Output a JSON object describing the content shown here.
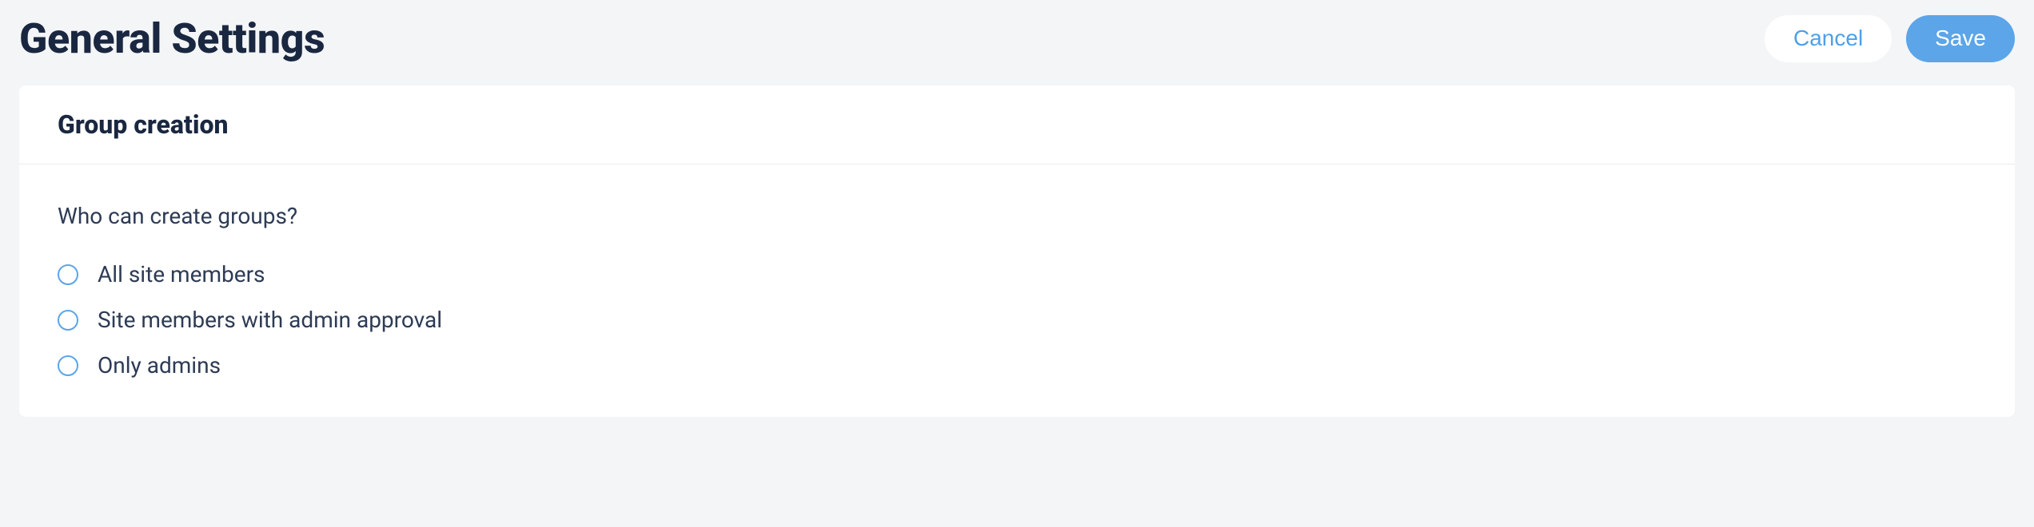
{
  "header": {
    "title": "General Settings",
    "cancel_label": "Cancel",
    "save_label": "Save"
  },
  "panel": {
    "title": "Group creation",
    "question": "Who can create groups?",
    "options": [
      {
        "label": "All site members"
      },
      {
        "label": "Site members with admin approval"
      },
      {
        "label": "Only admins"
      }
    ]
  }
}
